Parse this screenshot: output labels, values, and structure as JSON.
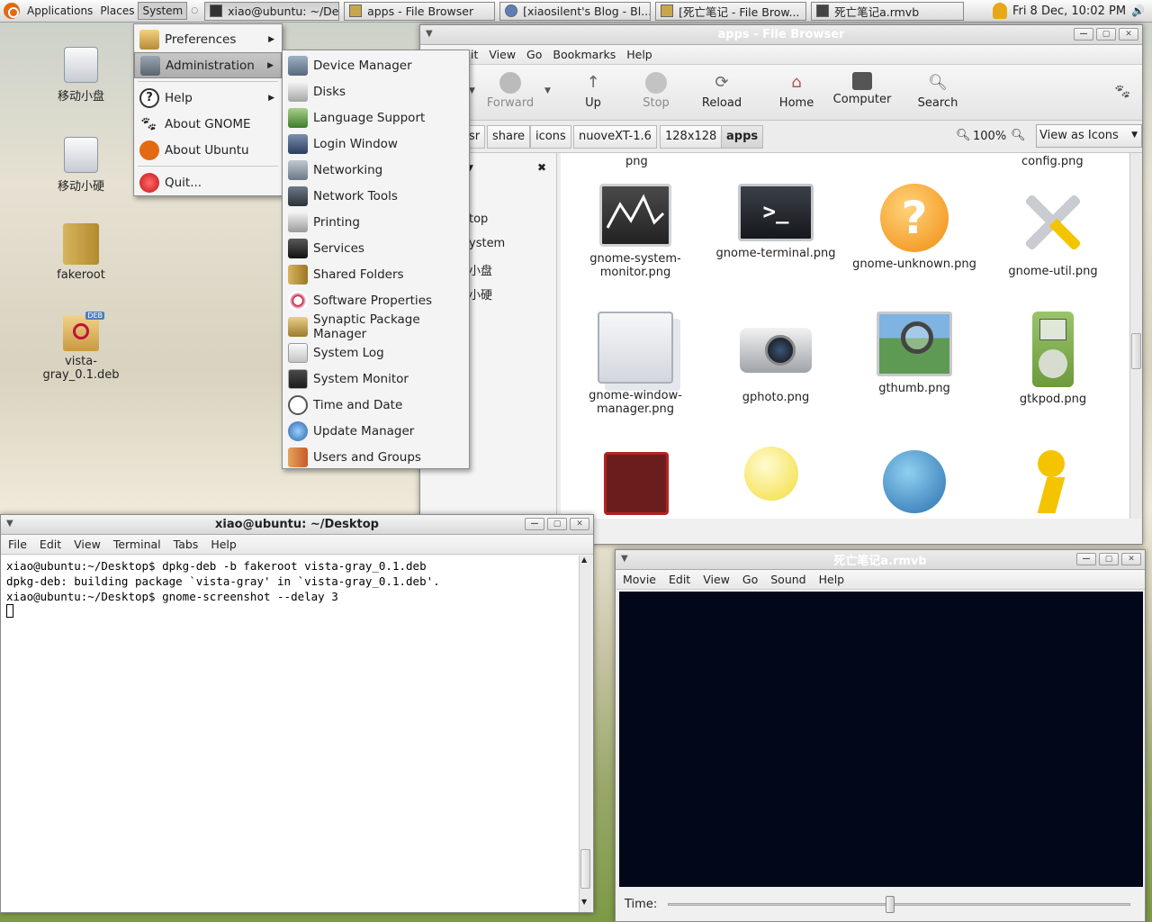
{
  "top_panel": {
    "menus": [
      "Applications",
      "Places",
      "System"
    ],
    "tasks": [
      {
        "label": "xiao@ubuntu: ~/De...",
        "active": true
      },
      {
        "label": "apps - File Browser",
        "active": false
      },
      {
        "label": "[xiaosilent's Blog - Bl...",
        "active": false
      },
      {
        "label": "[死亡笔记 - File Brow...",
        "active": false
      },
      {
        "label": "死亡笔记a.rmvb",
        "active": false
      }
    ],
    "clock": "Fri  8 Dec, 10:02 PM"
  },
  "desktop": {
    "icons": [
      {
        "label": "移动小盘",
        "icon": "usb-drive-icon"
      },
      {
        "label": "移动小硬",
        "icon": "usb-drive-icon"
      },
      {
        "label": "fakeroot",
        "icon": "folder-icon"
      },
      {
        "label": "vista-gray_0.1.deb",
        "icon": "deb-package-icon"
      }
    ]
  },
  "system_menu": {
    "items": [
      {
        "label": "Preferences",
        "icon": "preferences-icon",
        "submenu": true
      },
      {
        "label": "Administration",
        "icon": "administration-icon",
        "submenu": true,
        "selected": true
      },
      {
        "label": "Help",
        "icon": "help-icon",
        "submenu": true
      },
      {
        "label": "About GNOME",
        "icon": "gnome-foot-icon"
      },
      {
        "label": "About Ubuntu",
        "icon": "ubuntu-icon"
      },
      {
        "label": "Quit...",
        "icon": "quit-icon"
      }
    ]
  },
  "admin_menu": {
    "items": [
      {
        "label": "Device Manager",
        "icon": "device-manager-icon"
      },
      {
        "label": "Disks",
        "icon": "disks-icon"
      },
      {
        "label": "Language Support",
        "icon": "language-support-icon"
      },
      {
        "label": "Login Window",
        "icon": "login-window-icon"
      },
      {
        "label": "Networking",
        "icon": "networking-icon"
      },
      {
        "label": "Network Tools",
        "icon": "network-tools-icon"
      },
      {
        "label": "Printing",
        "icon": "printer-icon"
      },
      {
        "label": "Services",
        "icon": "services-icon"
      },
      {
        "label": "Shared Folders",
        "icon": "shared-folders-icon"
      },
      {
        "label": "Software Properties",
        "icon": "software-properties-icon"
      },
      {
        "label": "Synaptic Package Manager",
        "icon": "synaptic-icon"
      },
      {
        "label": "System Log",
        "icon": "system-log-icon"
      },
      {
        "label": "System Monitor",
        "icon": "system-monitor-icon"
      },
      {
        "label": "Time and Date",
        "icon": "clock-icon"
      },
      {
        "label": "Update Manager",
        "icon": "update-manager-icon"
      },
      {
        "label": "Users and Groups",
        "icon": "users-groups-icon"
      }
    ]
  },
  "file_browser": {
    "title": "apps - File Browser",
    "menu": [
      "it",
      "View",
      "Go",
      "Bookmarks",
      "Help"
    ],
    "toolbar": {
      "forward": "Forward",
      "up": "Up",
      "stop": "Stop",
      "reload": "Reload",
      "home": "Home",
      "computer": "Computer",
      "search": "Search"
    },
    "breadcrumbs": [
      "sr",
      "share",
      "icons",
      "nuoveXT-1.6",
      "128x128",
      "apps"
    ],
    "zoom": "100%",
    "view_mode": "View as Icons",
    "side_items": [
      "top",
      "ystem",
      "小盘",
      "小硬"
    ],
    "files_partial_row": [
      "png",
      "config.png"
    ],
    "files": [
      {
        "label": "gnome-system-monitor.png",
        "icon": "system-monitor-file-icon"
      },
      {
        "label": "gnome-terminal.png",
        "icon": "terminal-file-icon"
      },
      {
        "label": "gnome-unknown.png",
        "icon": "unknown-file-icon"
      },
      {
        "label": "gnome-util.png",
        "icon": "tools-file-icon"
      },
      {
        "label": "gnome-window-manager.png",
        "icon": "window-manager-file-icon"
      },
      {
        "label": "gphoto.png",
        "icon": "camera-file-icon"
      },
      {
        "label": "gthumb.png",
        "icon": "image-viewer-file-icon"
      },
      {
        "label": "gtkpod.png",
        "icon": "ipod-file-icon"
      }
    ]
  },
  "terminal": {
    "title": "xiao@ubuntu: ~/Desktop",
    "menu": [
      "File",
      "Edit",
      "View",
      "Terminal",
      "Tabs",
      "Help"
    ],
    "lines": [
      "xiao@ubuntu:~/Desktop$ dpkg-deb -b fakeroot vista-gray_0.1.deb",
      "dpkg-deb: building package `vista-gray' in `vista-gray_0.1.deb'.",
      "xiao@ubuntu:~/Desktop$ gnome-screenshot --delay 3"
    ]
  },
  "player": {
    "title": "死亡笔记a.rmvb",
    "menu": [
      "Movie",
      "Edit",
      "View",
      "Go",
      "Sound",
      "Help"
    ],
    "time_label": "Time:",
    "progress": 0.48
  }
}
